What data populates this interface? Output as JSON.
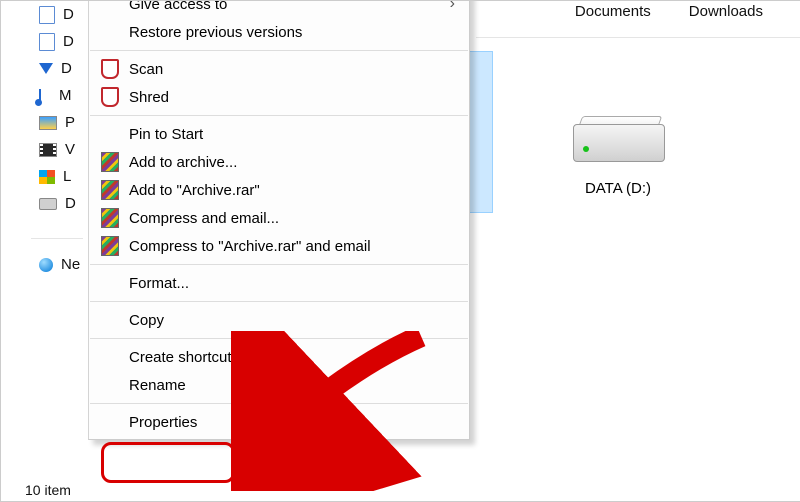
{
  "topnav": {
    "documents": "Documents",
    "downloads": "Downloads"
  },
  "tree": {
    "i0": "D",
    "i1": "D",
    "i2": "D",
    "i3": "M",
    "i4": "P",
    "i5": "V",
    "i6": "L",
    "i7": "D",
    "i8": "Ne"
  },
  "status": {
    "text": "10 item"
  },
  "drive": {
    "label": "DATA (D:)"
  },
  "menu": {
    "give_access": "Give access to",
    "restore_prev": "Restore previous versions",
    "scan": "Scan",
    "shred": "Shred",
    "pin_start": "Pin to Start",
    "add_archive": "Add to archive...",
    "add_to_rar": "Add to \"Archive.rar\"",
    "compress_email": "Compress and email...",
    "compress_to_rar_email": "Compress to \"Archive.rar\" and email",
    "format": "Format...",
    "copy": "Copy",
    "create_shortcut": "Create shortcut",
    "rename": "Rename",
    "properties": "Properties"
  }
}
